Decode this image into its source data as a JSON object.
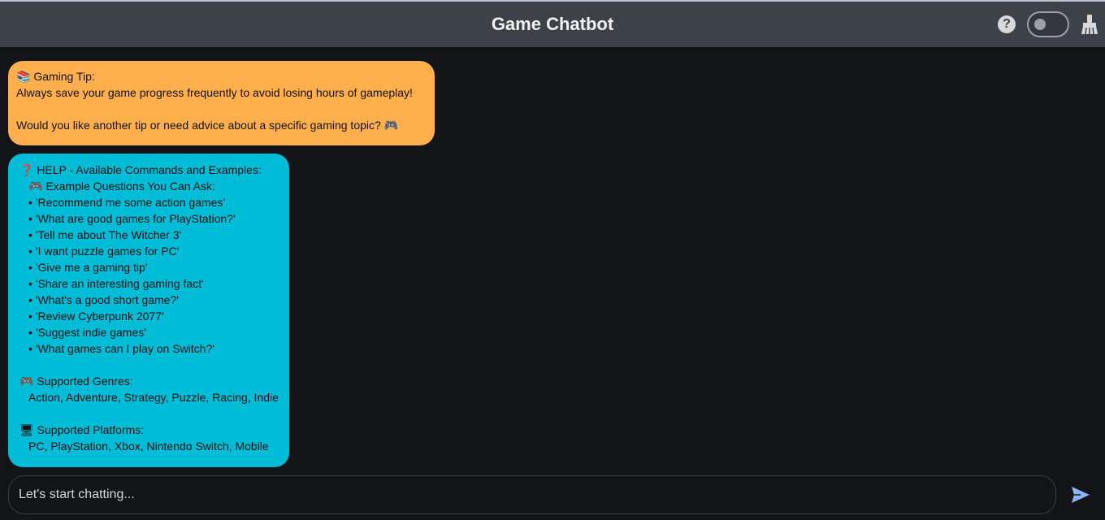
{
  "header": {
    "title": "Game Chatbot",
    "help_icon_glyph": "?",
    "help_icon": "help-circle-icon",
    "toggle": "theme-toggle",
    "clear_icon": "broom-icon"
  },
  "messages": [
    {
      "type": "tip",
      "color": "#ffb04d",
      "lines": [
        "📚 Gaming Tip:",
        "Always save your game progress frequently to avoid losing hours of gameplay!",
        "",
        "Would you like another tip or need advice about a specific gaming topic? 🎮"
      ]
    },
    {
      "type": "help",
      "color": "#00bcd6",
      "title": "❓ HELP - Available Commands and Examples:",
      "examples_header": "🎮 Example Questions You Can Ask:",
      "examples": [
        "• 'Recommend me some action games'",
        "• 'What are good games for PlayStation?'",
        "• 'Tell me about The Witcher 3'",
        "• 'I want puzzle games for PC'",
        "• 'Give me a gaming tip'",
        "• 'Share an interesting gaming fact'",
        "• 'What's a good short game?'",
        "• 'Review Cyberpunk 2077'",
        "• 'Suggest indie games'",
        "• 'What games can I play on Switch?'"
      ],
      "genres_header": "🎮 Supported Genres:",
      "genres": "Action, Adventure, Strategy, Puzzle, Racing, Indie",
      "platforms_header": "🖥 Supported Platforms:",
      "platforms": "PC, PlayStation, Xbox, Nintendo Switch, Mobile"
    }
  ],
  "input": {
    "placeholder": "Let's start chatting...",
    "send_icon": "send-icon"
  }
}
